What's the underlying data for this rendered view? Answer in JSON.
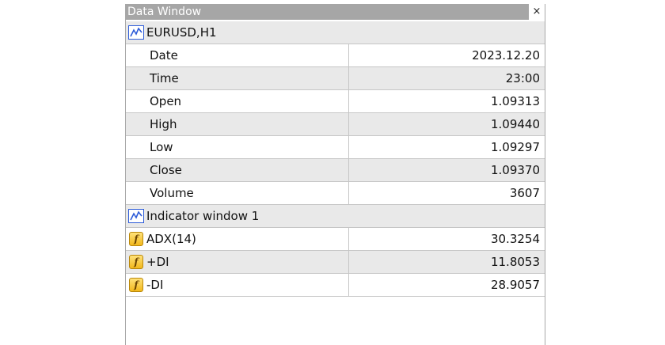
{
  "window": {
    "title": "Data Window",
    "close_glyph": "×"
  },
  "symbol_group": {
    "label": "EURUSD,H1",
    "icon": "chart-icon"
  },
  "symbol_rows": [
    {
      "label": "Date",
      "value": "2023.12.20"
    },
    {
      "label": "Time",
      "value": "23:00"
    },
    {
      "label": "Open",
      "value": "1.09313"
    },
    {
      "label": "High",
      "value": "1.09440"
    },
    {
      "label": "Low",
      "value": "1.09297"
    },
    {
      "label": "Close",
      "value": "1.09370"
    },
    {
      "label": "Volume",
      "value": "3607"
    }
  ],
  "indicator_group": {
    "label": "Indicator window 1",
    "icon": "chart-icon"
  },
  "indicator_rows": [
    {
      "label": "ADX(14)",
      "value": "30.3254",
      "icon": "function-icon"
    },
    {
      "label": "+DI",
      "value": "11.8053",
      "icon": "function-icon"
    },
    {
      "label": "-DI",
      "value": "28.9057",
      "icon": "function-icon"
    }
  ],
  "colors": {
    "title_bar": "#a6a6a6",
    "row_alt": "#e9e9e9",
    "icon_blue": "#2c5bd8",
    "icon_gold": "#f2b81c"
  }
}
